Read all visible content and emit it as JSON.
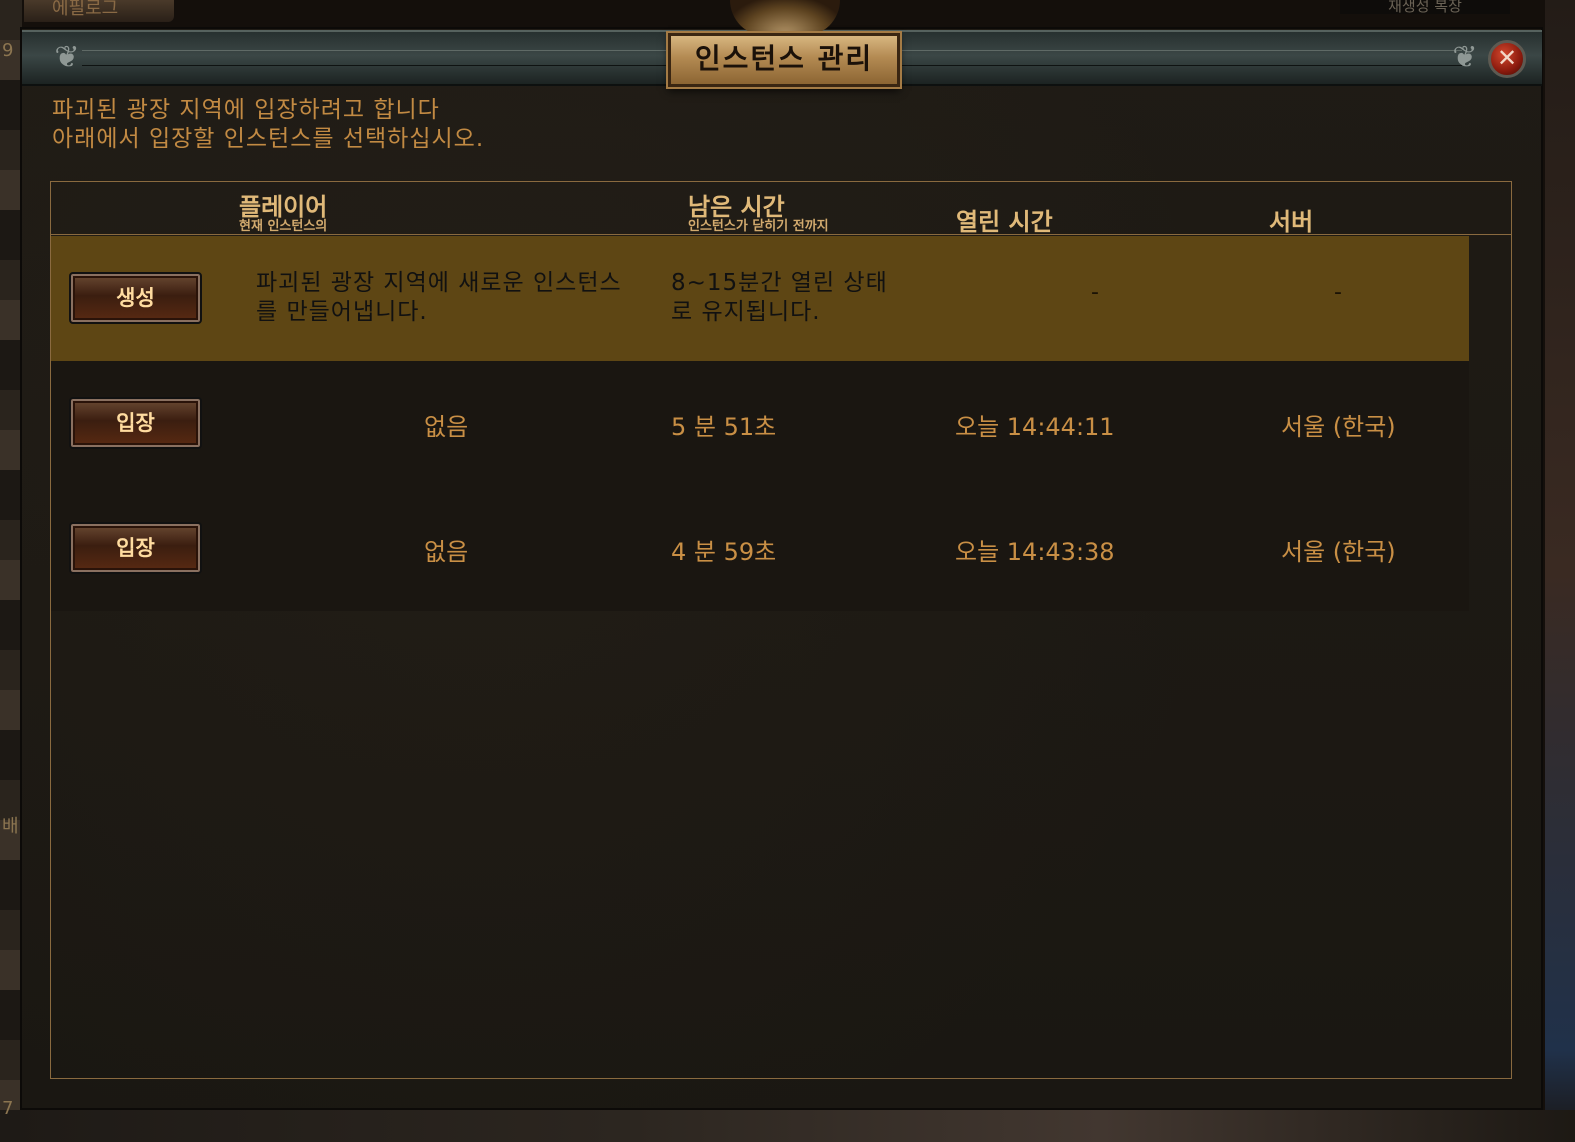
{
  "background": {
    "top_left_tab": "에필로그",
    "top_right_text": "재생성 복장",
    "left_edge_numbers": [
      "9",
      "7"
    ],
    "left_edge_char": "배"
  },
  "dialog": {
    "title": "인스턴스 관리",
    "close_icon": "close-icon",
    "intro_line1": "파괴된 광장 지역에 입장하려고 합니다",
    "intro_line2": "아래에서 입장할 인스턴스를 선택하십시오."
  },
  "table": {
    "headers": {
      "players": "플레이어",
      "players_sub": "현재 인스턴스의",
      "time_left": "남은 시간",
      "time_left_sub": "인스턴스가 닫히기 전까지",
      "opened": "열린 시간",
      "server": "서버"
    },
    "create_row": {
      "button": "생성",
      "desc_line1": "파괴된 광장 지역에 새로운 인스턴스",
      "desc_line2": "를 만들어냅니다.",
      "time_line1": "8~15분간 열린 상태",
      "time_line2": "로 유지됩니다.",
      "opened": "-",
      "server": "-"
    },
    "rows": [
      {
        "button": "입장",
        "players": "없음",
        "time_left": "5 분 51초",
        "opened": "오늘 14:44:11",
        "server": "서울 (한국)"
      },
      {
        "button": "입장",
        "players": "없음",
        "time_left": "4 분 59초",
        "opened": "오늘 14:43:38",
        "server": "서울 (한국)"
      }
    ]
  }
}
